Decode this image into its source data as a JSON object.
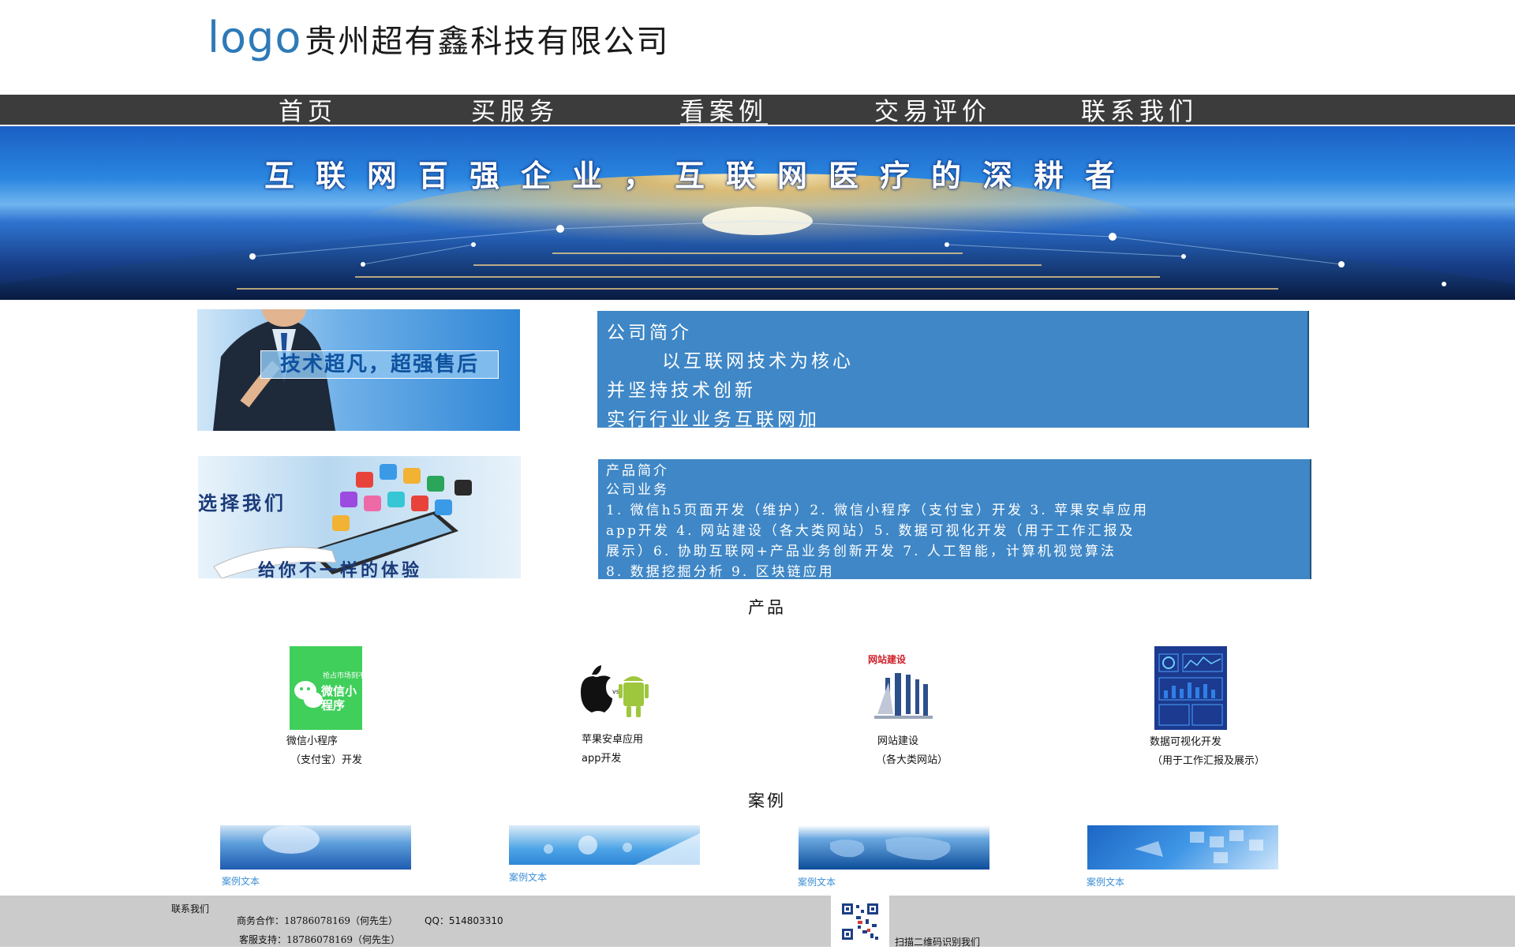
{
  "header": {
    "logo_mark": "logo",
    "company_name": "贵州超有鑫科技有限公司"
  },
  "nav": {
    "items": [
      {
        "label": "首页"
      },
      {
        "label": "买服务"
      },
      {
        "label": "看案例"
      },
      {
        "label": "交易评价"
      },
      {
        "label": "联系我们"
      }
    ],
    "active": "看案例"
  },
  "banner": {
    "title": "互联网百强企业，互联网医疗的深耕者"
  },
  "intro": {
    "image1_caption": "技术超凡，超强售后",
    "image2_caption_top": "选择我们",
    "image2_caption_bottom": "给你不一样的体验",
    "company_panel": {
      "title": "公司简介",
      "lines": [
        "以互联网技术为核心",
        "并坚持技术创新",
        "实行行业业务互联网加"
      ]
    },
    "product_panel": {
      "title": "产品简介",
      "subtitle": "公司业务",
      "lines": [
        "1. 微信h5页面开发（维护）2. 微信小程序（支付宝）开发 3. 苹果安卓应用",
        "app开发 4. 网站建设（各大类网站）5. 数据可视化开发（用于工作汇报及",
        "展示）6. 协助互联网+产品业务创新开发 7. 人工智能，计算机视觉算法",
        "8. 数据挖掘分析 9. 区块链应用"
      ]
    }
  },
  "products": {
    "title": "产品",
    "items": [
      {
        "line1": "微信小程序",
        "line2": "（支付宝）开发",
        "image_text_small": "抢占市场刻不容缓",
        "image_text": "微信小程序",
        "accent": "#3fcf5a",
        "icon": "wechat-icon"
      },
      {
        "line1": "苹果安卓应用",
        "line2": "app开发",
        "image_text": "vs",
        "accent": "#9ec73d",
        "icon": "apple-android-icon"
      },
      {
        "line1": "网站建设",
        "line2": "（各大类网站）",
        "image_text": "网站建设",
        "accent": "#d0202a",
        "icon": "www-icon"
      },
      {
        "line1": "数据可视化开发",
        "line2": "（用于工作汇报及展示）",
        "accent": "#1c3a8f",
        "icon": "dashboard-icon"
      }
    ]
  },
  "cases": {
    "title": "案例",
    "items": [
      {
        "label": "案例文本"
      },
      {
        "label": "案例文本"
      },
      {
        "label": "案例文本"
      },
      {
        "label": "案例文本"
      }
    ]
  },
  "footer": {
    "contact_title": "联系我们",
    "business": "商务合作：18786078169（何先生）",
    "qq": "QQ：514803310",
    "support": "客服支持：18786078169（何先生）",
    "qr_caption": "扫描二维码识别我们"
  },
  "colors": {
    "nav_bg": "#3c3c3c",
    "panel_bg": "#3f87c6",
    "logo": "#2e7ab8",
    "footer_bg": "#cbcbcb"
  }
}
